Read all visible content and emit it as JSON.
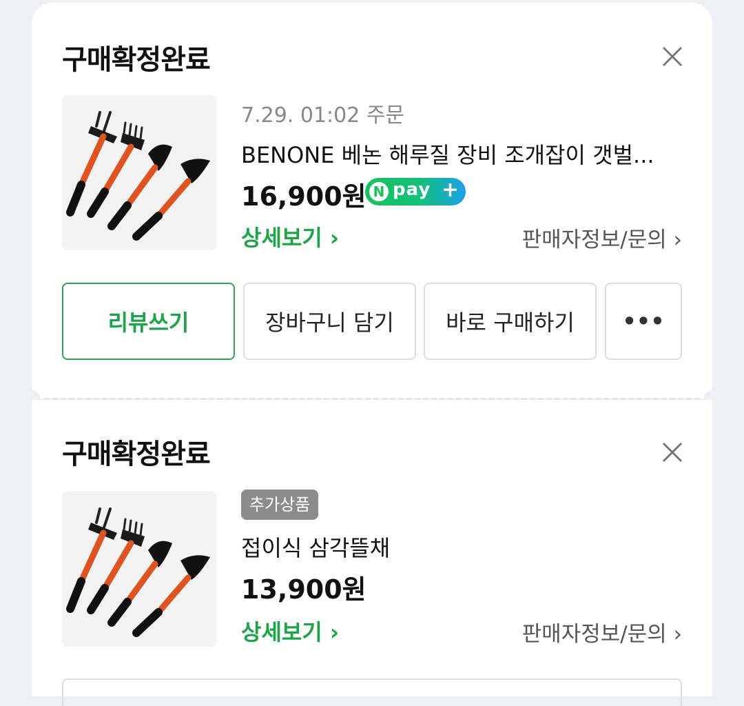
{
  "orders": [
    {
      "status": "구매확정완료",
      "order_date": "7.29. 01:02 주문",
      "product_name": "BENONE 베논 해루질 장비 조개잡이 갯벌...",
      "price": "16,900원",
      "npay": {
        "n": "N",
        "label": "pay",
        "plus": "+"
      },
      "detail_link": "상세보기 ›",
      "seller_link": "판매자정보/문의 ›",
      "actions": {
        "review": "리뷰쓰기",
        "cart": "장바구니 담기",
        "buy_now": "바로 구매하기",
        "more": "•••"
      }
    },
    {
      "status": "구매확정완료",
      "badge": "추가상품",
      "product_name": "접이식 삼각뜰채",
      "price": "13,900원",
      "detail_link": "상세보기 ›",
      "seller_link": "판매자정보/문의 ›"
    }
  ],
  "colors": {
    "accent_green": "#19a646",
    "background": "#eef0f3"
  },
  "icons": [
    "close-icon",
    "garden-tools-image",
    "chevron-right-icon"
  ]
}
